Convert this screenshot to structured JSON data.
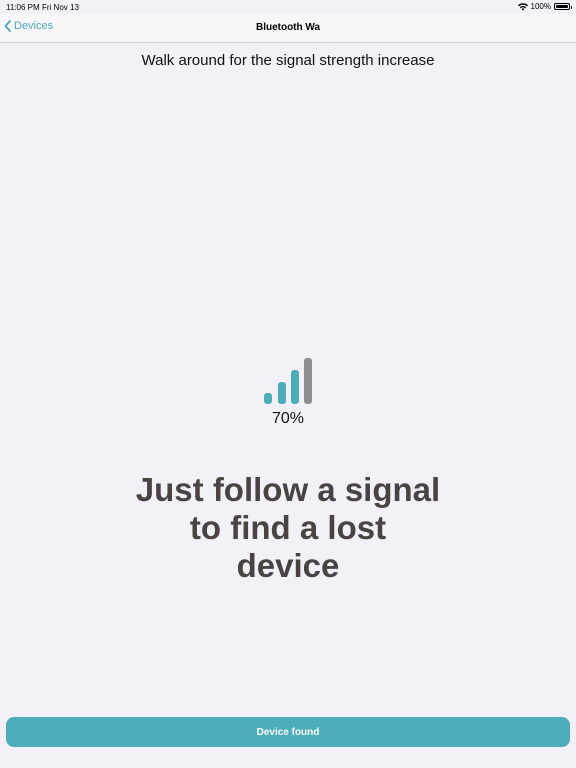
{
  "status_bar": {
    "time": "11:06 PM",
    "date": "Fri Nov 13",
    "battery": "100%",
    "icons": [
      "wifi-icon",
      "battery-icon"
    ]
  },
  "nav": {
    "back_label": "Devices",
    "back_icon": "chevron-left-icon",
    "title": "Bluetooth Wa"
  },
  "main": {
    "instruction": "Walk around for the signal strength increase",
    "signal": {
      "icon": "signal-strength-icon",
      "level": 0.7,
      "bars_total": 4,
      "bars_active": 3,
      "active_color": "#4cacb7",
      "inactive_color": "#8e8e93"
    },
    "percentage": "70%",
    "headline_lines": [
      "Just follow a signal",
      "to find a lost",
      "device"
    ]
  },
  "footer": {
    "button_label": "Device found",
    "button_color": "#4cacb7"
  },
  "colors": {
    "accent": "#4aa7b3",
    "background": "#f2f1f7",
    "headline": "#4a4344"
  }
}
